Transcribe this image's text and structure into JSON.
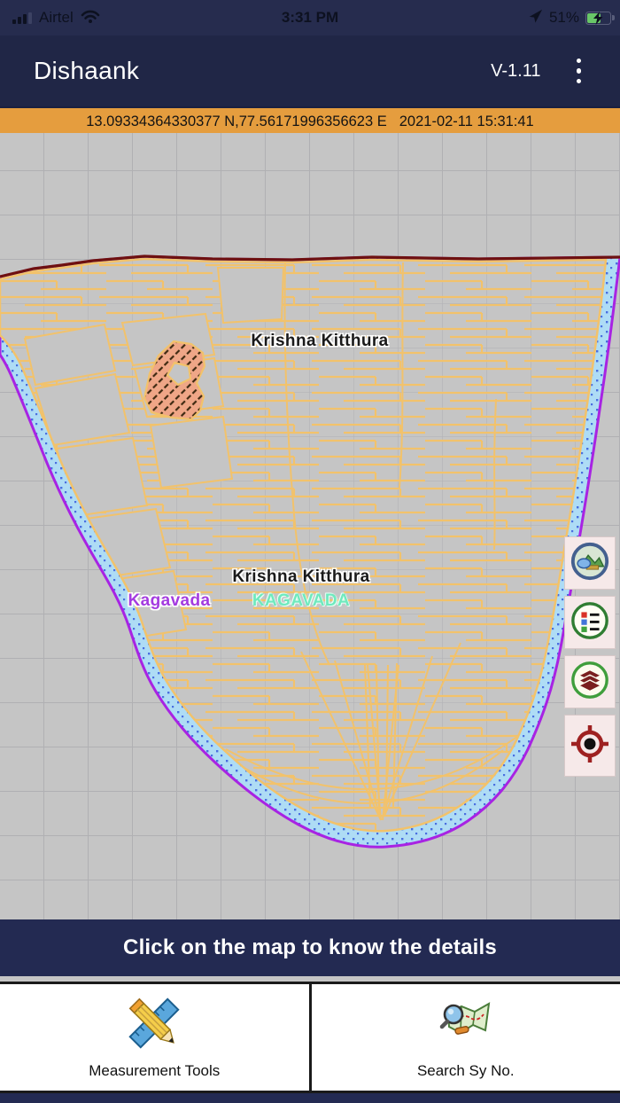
{
  "status_bar": {
    "carrier": "Airtel",
    "time": "3:31 PM",
    "battery_percent": "51%"
  },
  "app_bar": {
    "title": "Dishaank",
    "version": "V-1.11"
  },
  "coordinate_bar": {
    "coordinates": "13.09334364330377 N,77.56171996356623 E",
    "timestamp": "2021-02-11 15:31:41"
  },
  "map": {
    "labels": {
      "village_label_top": "Krishna Kitthura",
      "village_label_bottom": "Krishna Kitthura",
      "place_label_magenta": "Kagavada",
      "place_label_teal": "KAGAVADA"
    },
    "colors": {
      "parcel_line": "#F2C26B",
      "village_boundary": "#A823E3",
      "water_band": "#AEDCF5",
      "water_dots": "#4A6FE0",
      "top_boundary": "#6E1010",
      "selected_parcel_fill": "#EFA687",
      "label_magenta": "#A43BE0",
      "label_teal": "#70E9BE",
      "map_background": "#C5C5C5"
    },
    "controls": [
      {
        "name": "overview-map"
      },
      {
        "name": "legend"
      },
      {
        "name": "layers"
      },
      {
        "name": "my-location"
      }
    ]
  },
  "hint_bar": {
    "text": "Click on the map to know the details"
  },
  "toolbar": {
    "measurement_label": "Measurement Tools",
    "search_label": "Search Sy No."
  }
}
